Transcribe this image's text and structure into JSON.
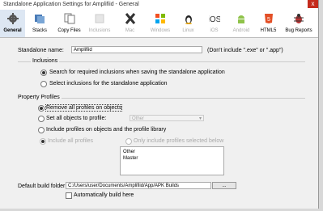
{
  "window": {
    "title": "Standalone Application Settings for Amplifiid - General",
    "close_glyph": "x"
  },
  "toolbar": {
    "items": [
      {
        "label": "General",
        "icon": "gear-icon",
        "selected": true,
        "enabled": true
      },
      {
        "label": "Stacks",
        "icon": "stacks-icon",
        "selected": false,
        "enabled": true
      },
      {
        "label": "Copy Files",
        "icon": "copy-files-icon",
        "selected": false,
        "enabled": true
      },
      {
        "label": "Inclusions",
        "icon": "inclusions-icon",
        "selected": false,
        "enabled": false
      },
      {
        "label": "Mac",
        "icon": "mac-x-icon",
        "selected": false,
        "enabled": false
      },
      {
        "label": "Windows",
        "icon": "windows-icon",
        "selected": false,
        "enabled": false
      },
      {
        "label": "Linux",
        "icon": "linux-penguin-icon",
        "selected": false,
        "enabled": false
      },
      {
        "label": "iOS",
        "icon": "ios-icon",
        "selected": false,
        "enabled": false
      },
      {
        "label": "Android",
        "icon": "android-icon",
        "selected": false,
        "enabled": false
      },
      {
        "label": "HTML5",
        "icon": "html5-icon",
        "selected": false,
        "enabled": true
      },
      {
        "label": "Bug Reports",
        "icon": "bug-icon",
        "selected": false,
        "enabled": true
      }
    ]
  },
  "standalone": {
    "label": "Standalone name:",
    "value": "Amplifiid",
    "hint": "(Don't include \".exe\" or \".app\")"
  },
  "inclusions": {
    "title": "Inclusions",
    "search_label": "Search for required inclusions when saving the standalone application",
    "select_label": "Select inclusions for the standalone application",
    "selected": "search"
  },
  "profiles": {
    "title": "Property Profiles",
    "remove_label": "Remove all profiles on objects",
    "set_label": "Set all objects to profile:",
    "set_select_value": "Other",
    "include_label": "Include profiles on objects and the profile library",
    "include_all_label": "Include all profiles",
    "only_include_label": "Only include profiles selected below",
    "selected": "remove",
    "list": [
      "Other",
      "Master"
    ]
  },
  "build": {
    "folder_label": "Default build folder:",
    "folder_value": "C:/Users/user/Documents/Amplifiid/App/APK Builds",
    "browse_label": "...",
    "auto_label": "Automatically build here"
  },
  "colors": {
    "accent_selected": "#dde7f3",
    "close_red": "#c42b1c",
    "disabled_text": "#aaaaaa"
  }
}
